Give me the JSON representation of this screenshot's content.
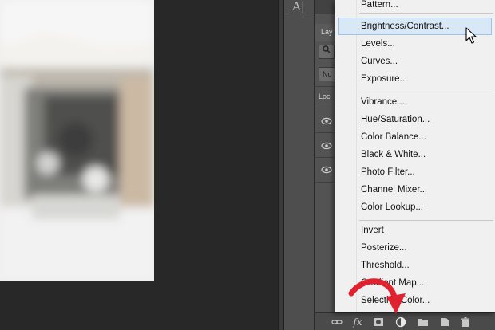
{
  "toolbar": {
    "type_tool_icon": "A|"
  },
  "layers_panel": {
    "tab_label": "Lay",
    "blend_mode_value": "No",
    "lock_label": "Loc",
    "rows": 3
  },
  "adjustment_menu": {
    "items": [
      {
        "label": "Pattern...",
        "highlighted": false
      },
      {
        "label": "Brightness/Contrast...",
        "highlighted": true
      },
      {
        "label": "Levels...",
        "highlighted": false
      },
      {
        "label": "Curves...",
        "highlighted": false
      },
      {
        "label": "Exposure...",
        "highlighted": false
      },
      {
        "label": "Vibrance...",
        "highlighted": false
      },
      {
        "label": "Hue/Saturation...",
        "highlighted": false
      },
      {
        "label": "Color Balance...",
        "highlighted": false
      },
      {
        "label": "Black & White...",
        "highlighted": false
      },
      {
        "label": "Photo Filter...",
        "highlighted": false
      },
      {
        "label": "Channel Mixer...",
        "highlighted": false
      },
      {
        "label": "Color Lookup...",
        "highlighted": false
      },
      {
        "label": "Invert",
        "highlighted": false
      },
      {
        "label": "Posterize...",
        "highlighted": false
      },
      {
        "label": "Threshold...",
        "highlighted": false
      },
      {
        "label": "Gradient Map...",
        "highlighted": false
      },
      {
        "label": "Selective Color...",
        "highlighted": false
      }
    ]
  },
  "bottom_bar": {
    "fx_label": "fx"
  },
  "colors": {
    "menu_bg": "#f0f0f0",
    "highlight_bg": "#d9e8f7",
    "highlight_border": "#9fc2e7",
    "panel_bg": "#535353",
    "arrow": "#e0212f"
  }
}
